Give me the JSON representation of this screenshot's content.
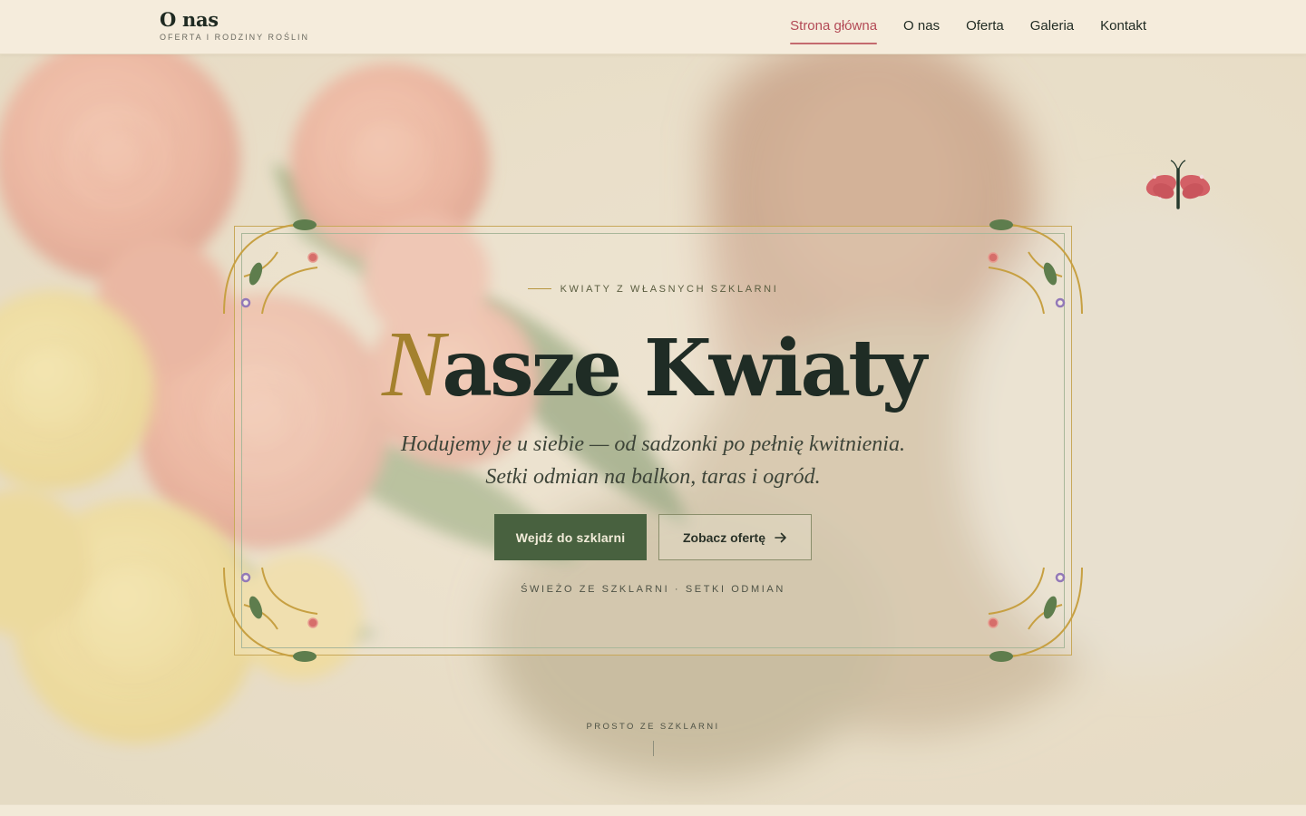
{
  "header": {
    "brand_title": "O nas",
    "brand_subtitle": "OFERTA I RODZINY ROŚLIN",
    "nav": [
      {
        "label": "Strona główna",
        "active": true
      },
      {
        "label": "O nas",
        "active": false
      },
      {
        "label": "Oferta",
        "active": false
      },
      {
        "label": "Galeria",
        "active": false
      },
      {
        "label": "Kontakt",
        "active": false
      }
    ]
  },
  "hero": {
    "eyebrow": "KWIATY Z WŁASNYCH SZKLARNI",
    "title_first_letter": "N",
    "title_rest": "asze Kwiaty",
    "lead": "Hodujemy je u siebie — od sadzonki po pełnię kwitnienia. Setki odmian na balkon, taras i ogród.",
    "primary_button": "Wejdź do szklarni",
    "secondary_button": "Zobacz ofertę",
    "secondary_icon": "arrow-right-icon",
    "tagline": "ŚWIEŻO ZE SZKLARNI · SETKI ODMIAN",
    "scroll_label": "PROSTO ZE SZKLARNI",
    "decor_icon": "butterfly-icon"
  },
  "colors": {
    "accent_pink": "#b34a56",
    "gold": "#a4812e",
    "button_green": "#48613f",
    "background_cream": "#f4ecdc"
  }
}
